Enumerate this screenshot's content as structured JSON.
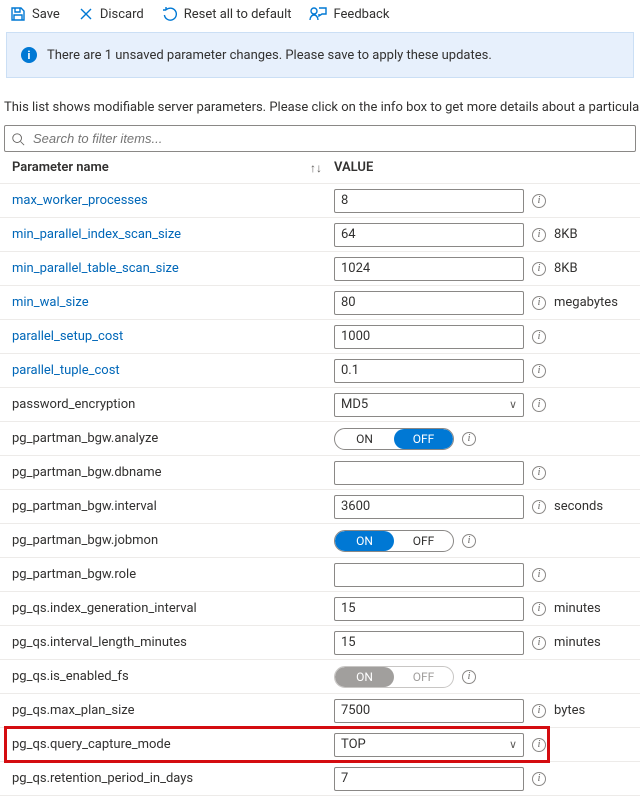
{
  "toolbar": {
    "save": "Save",
    "discard": "Discard",
    "reset": "Reset all to default",
    "feedback": "Feedback"
  },
  "notice": "There are 1 unsaved parameter changes.  Please save to apply these updates.",
  "description": "This list shows modifiable server parameters. Please click on the info box to get more details about a particular",
  "search": {
    "placeholder": "Search to filter items..."
  },
  "columns": {
    "name": "Parameter name",
    "value": "VALUE"
  },
  "rows": [
    {
      "name": "max_worker_processes",
      "link": true,
      "type": "text",
      "value": "8",
      "unit": ""
    },
    {
      "name": "min_parallel_index_scan_size",
      "link": true,
      "type": "text",
      "value": "64",
      "unit": "8KB"
    },
    {
      "name": "min_parallel_table_scan_size",
      "link": true,
      "type": "text",
      "value": "1024",
      "unit": "8KB"
    },
    {
      "name": "min_wal_size",
      "link": true,
      "type": "text",
      "value": "80",
      "unit": "megabytes"
    },
    {
      "name": "parallel_setup_cost",
      "link": true,
      "type": "text",
      "value": "1000",
      "unit": ""
    },
    {
      "name": "parallel_tuple_cost",
      "link": true,
      "type": "text",
      "value": "0.1",
      "unit": ""
    },
    {
      "name": "password_encryption",
      "link": false,
      "type": "select",
      "value": "MD5",
      "unit": ""
    },
    {
      "name": "pg_partman_bgw.analyze",
      "link": false,
      "type": "toggle",
      "value": "OFF",
      "unit": ""
    },
    {
      "name": "pg_partman_bgw.dbname",
      "link": false,
      "type": "text",
      "value": "",
      "unit": ""
    },
    {
      "name": "pg_partman_bgw.interval",
      "link": false,
      "type": "text",
      "value": "3600",
      "unit": "seconds"
    },
    {
      "name": "pg_partman_bgw.jobmon",
      "link": false,
      "type": "toggle",
      "value": "ON",
      "unit": ""
    },
    {
      "name": "pg_partman_bgw.role",
      "link": false,
      "type": "text",
      "value": "",
      "unit": ""
    },
    {
      "name": "pg_qs.index_generation_interval",
      "link": false,
      "type": "text",
      "value": "15",
      "unit": "minutes"
    },
    {
      "name": "pg_qs.interval_length_minutes",
      "link": false,
      "type": "text",
      "value": "15",
      "unit": "minutes"
    },
    {
      "name": "pg_qs.is_enabled_fs",
      "link": false,
      "type": "toggle",
      "value": "ON",
      "unit": "",
      "disabled": true
    },
    {
      "name": "pg_qs.max_plan_size",
      "link": false,
      "type": "text",
      "value": "7500",
      "unit": "bytes"
    },
    {
      "name": "pg_qs.query_capture_mode",
      "link": false,
      "type": "select",
      "value": "TOP",
      "unit": "",
      "highlight": true
    },
    {
      "name": "pg_qs.retention_period_in_days",
      "link": false,
      "type": "text",
      "value": "7",
      "unit": ""
    }
  ],
  "toggle_labels": {
    "on": "ON",
    "off": "OFF"
  }
}
